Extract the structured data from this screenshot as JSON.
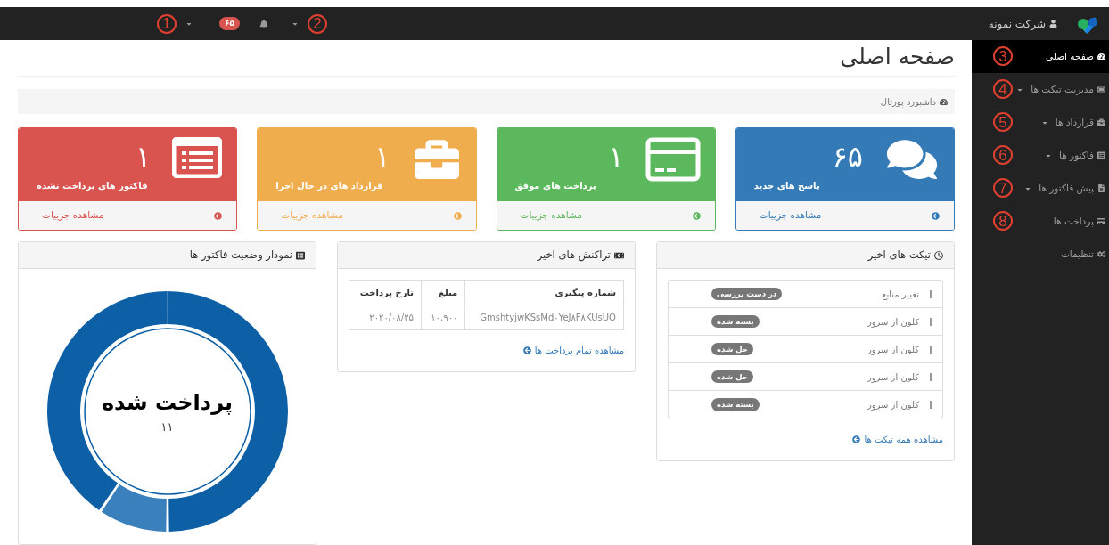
{
  "topbar": {
    "brand": "شرکت نمونه",
    "notification_count": "۶۵",
    "markers": [
      "2",
      "1"
    ]
  },
  "sidebar": {
    "items": [
      {
        "label": "صفحه اصلی",
        "selected": true,
        "dropdown": false,
        "marker": "3"
      },
      {
        "label": "مدیریت تیکت ها",
        "selected": false,
        "dropdown": true,
        "marker": "4"
      },
      {
        "label": "قرارداد ها",
        "selected": false,
        "dropdown": true,
        "marker": "5"
      },
      {
        "label": "فاکتور ها",
        "selected": false,
        "dropdown": true,
        "marker": "6"
      },
      {
        "label": "پیش فاکتور ها",
        "selected": false,
        "dropdown": true,
        "marker": "7"
      },
      {
        "label": "پرداخت ها",
        "selected": false,
        "dropdown": false,
        "marker": "8"
      },
      {
        "label": "تنظیمات",
        "selected": false,
        "dropdown": false
      }
    ]
  },
  "page": {
    "title": "صفحه اصلی",
    "breadcrumb": "داشبورد پورتال"
  },
  "cards": [
    {
      "kind": "messages",
      "color": "#337ab7",
      "count": "۶۵",
      "label": "پاسخ های جدید",
      "link": "مشاهده جزییات"
    },
    {
      "kind": "payments",
      "color": "#5cb85c",
      "count": "۱",
      "label": "پرداخت های موفق",
      "link": "مشاهده جزییات"
    },
    {
      "kind": "contracts",
      "color": "#f0ad4e",
      "count": "۱",
      "label": "قرارداد های در حال اجرا",
      "link": "مشاهده جزییات"
    },
    {
      "kind": "invoices",
      "color": "#d9534f",
      "count": "۱",
      "label": "فاکتور های پرداخت نشده",
      "link": "مشاهده جزییات"
    }
  ],
  "tickets": {
    "title": "تیکت های اخیر",
    "rows": [
      {
        "subject": "تغییر منابع",
        "status": "در دست بررسی"
      },
      {
        "subject": "کلون از سرور",
        "status": "بسته شده"
      },
      {
        "subject": "کلون از سرور",
        "status": "حل شده"
      },
      {
        "subject": "کلون از سرور",
        "status": "حل شده"
      },
      {
        "subject": "کلون از سرور",
        "status": "بسته شده"
      }
    ],
    "link": "مشاهده همه تیکت ها"
  },
  "transactions": {
    "title": "تراکنش های اخیر",
    "columns": [
      "شماره پیگیری",
      "مبلغ",
      "تارخ پرداخت"
    ],
    "rows": [
      [
        "GmshtyjwKSsMd۰YeJ۸F۸KUsUQ",
        "۱۰,۹۰۰",
        "۲۰۲۰/۰۸/۲۵"
      ]
    ],
    "link": "مشاهده تمام پرداخت ها"
  },
  "invoice_chart": {
    "title": "نمودار وضعیت فاکتور ها",
    "center_label": "پرداخت شده",
    "center_value": "۱۱"
  }
}
